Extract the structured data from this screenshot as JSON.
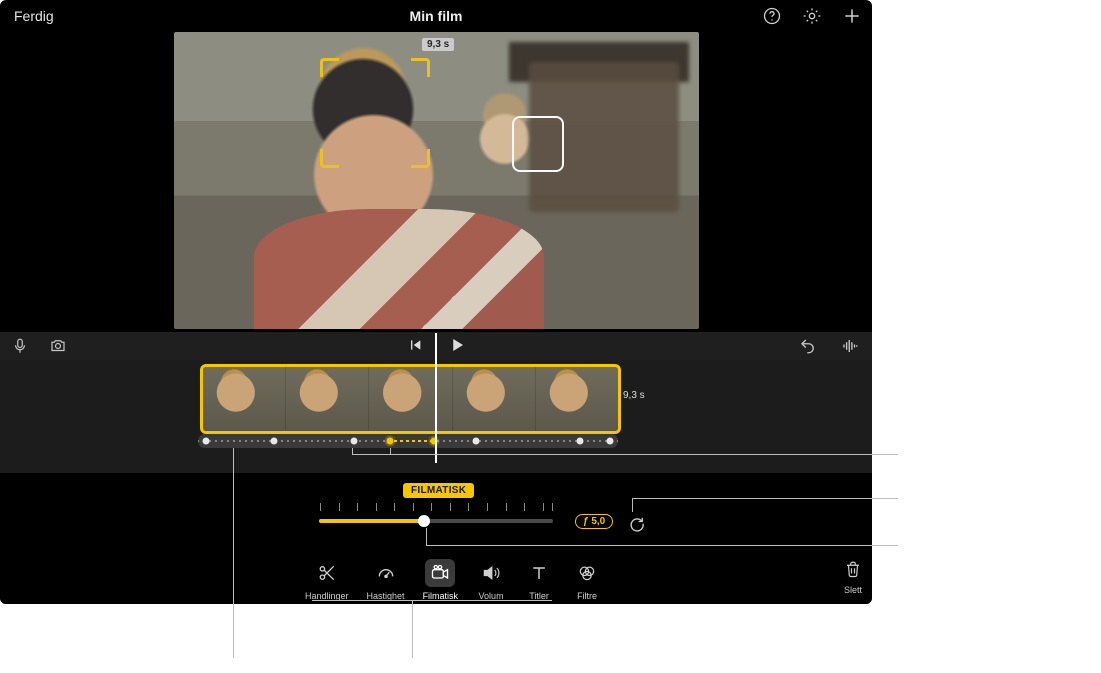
{
  "topbar": {
    "done_label": "Ferdig",
    "title": "Min film"
  },
  "preview": {
    "duration_badge": "9,3 s"
  },
  "timeline": {
    "clip_duration": "9,3 s"
  },
  "cinematic": {
    "badge": "FILMATISK",
    "aperture_label": "ƒ 5,0",
    "slider_fill_percent": 45
  },
  "tools": {
    "actions": "Handlinger",
    "speed": "Hastighet",
    "cinematic": "Filmatisk",
    "volume": "Volum",
    "titles": "Titler",
    "filters": "Filtre",
    "delete": "Slett"
  },
  "icons": {
    "help": "help-icon",
    "settings": "gear-icon",
    "add": "plus-icon",
    "mic": "mic-icon",
    "camera": "camera-icon",
    "prev": "skip-back-icon",
    "play": "play-icon",
    "undo": "undo-icon",
    "waveform": "waveform-icon",
    "reset": "reset-icon",
    "scissors": "scissors-icon",
    "gauge": "gauge-icon",
    "cine_cam": "cine-camera-icon",
    "speaker": "speaker-icon",
    "text_t": "title-t-icon",
    "filters_icon": "filters-icon",
    "trash": "trash-icon",
    "video_badge": "video-badge-icon"
  }
}
